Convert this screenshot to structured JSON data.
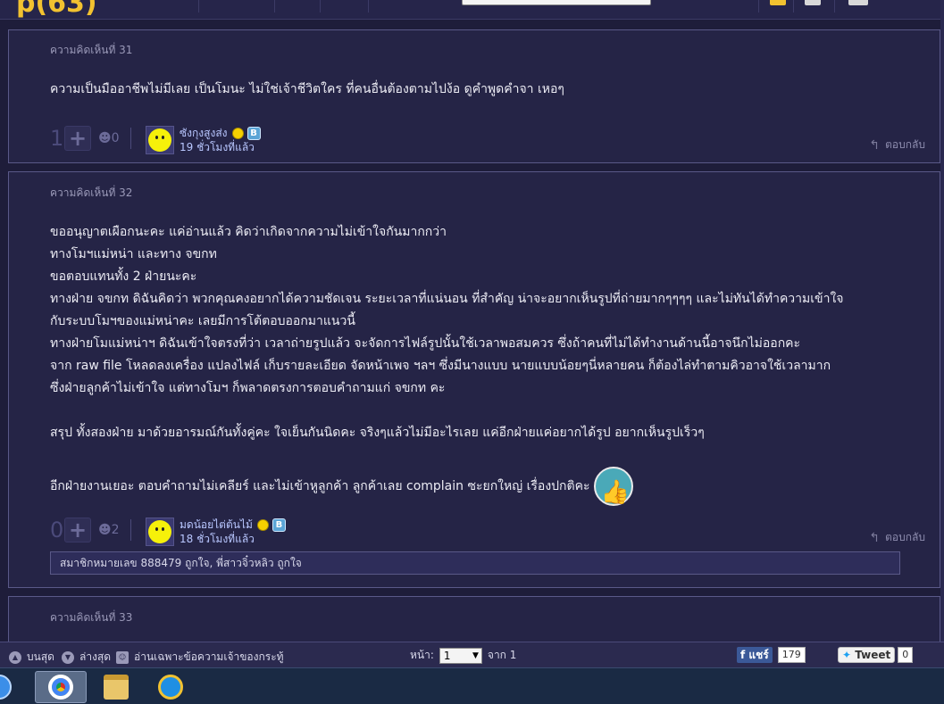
{
  "topbar": {
    "brand": "p(63)"
  },
  "posts": [
    {
      "number": "ความคิดเห็นที่ 31",
      "body": [
        "ความเป็นมืออาชีพไม่มีเลย เป็นโมนะ ไม่ใช่เจ้าชีวิตใคร ที่คนอื่นต้องตามไปง้อ ดูคำพูดคำจา เหอๆ"
      ],
      "votes": "1",
      "emotions": "0",
      "author": "ซังกุงสูงส่ง",
      "badge": "B",
      "time": "19 ชั่วโมงที่แล้ว",
      "reply": "ตอบกลับ"
    },
    {
      "number": "ความคิดเห็นที่ 32",
      "body": [
        "ขออนุญาตเผือกนะคะ แค่อ่านแล้ว คิดว่าเกิดจากความไม่เข้าใจกันมากกว่า",
        "ทางโมฯแม่หน่า และทาง จขกท",
        "ขอตอบแทนทั้ง 2 ฝ่ายนะคะ",
        "ทางฝ่าย จขกท ดิฉันคิดว่า พวกคุณคงอยากได้ความชัดเจน ระยะเวลาที่แน่นอน ที่สำคัญ น่าจะอยากเห็นรูปที่ถ่ายมากๆๆๆๆ และไม่ทันได้ทำความเข้าใจ",
        "กับระบบโมฯของแม่หน่าคะ เลยมีการโต้ตอบออกมาแนวนี้",
        "ทางฝ่ายโมแม่หน่าฯ ดิฉันเข้าใจตรงที่ว่า เวลาถ่ายรูปแล้ว จะจัดการไฟล์รูปนั้นใช้เวลาพอสมควร ซึ่งถ้าคนที่ไม่ได้ทำงานด้านนี้อาจนึกไม่ออกคะ",
        "จาก raw file โหลดลงเครื่อง แปลงไฟล์ เก็บรายละเอียด จัดหน้าเพจ ฯลฯ ซึ่งมีนางแบบ นายแบบน้อยๆนี่หลายคน ก็ต้องไล่ทำตามคิวอาจใช้เวลามาก",
        "ซึ่งฝ่ายลูกค้าไม่เข้าใจ แต่ทางโมฯ ก็พลาดตรงการตอบคำถามแก่ จขกท คะ",
        "",
        "สรุป ทั้งสองฝ่าย มาด้วยอารมณ์กันทั้งคู่คะ ใจเย็นกันนิดคะ จริงๆแล้วไม่มีอะไรเลย แค่อีกฝ่ายแค่อยากได้รูป อยากเห็นรูปเร็วๆ",
        "",
        "อีกฝ่ายงานเยอะ ตอบคำถามไม่เคลียร์ และไม่เข้าหูลูกค้า ลูกค้าเลย complain ซะยกใหญ่  เรื่องปกติคะ"
      ],
      "votes": "0",
      "emotions": "2",
      "author": "มดน้อยไต่ต้นไม้",
      "badge": "B",
      "time": "18 ชั่วโมงที่แล้ว",
      "reply": "ตอบกลับ",
      "likes": "สมาชิกหมายเลข 888479 ถูกใจ, พี่สาวจิ๋วหลิว ถูกใจ"
    },
    {
      "number": "ความคิดเห็นที่ 33"
    }
  ],
  "bottom": {
    "top_label": "บนสุด",
    "bottom_label": "ล่างสุด",
    "owner_only": "อ่านเฉพาะข้อความเจ้าของกระทู้",
    "page_label": "หน้า:",
    "page_value": "1",
    "of_label": "จาก 1",
    "share_label": "แชร์",
    "share_count": "179",
    "tweet_label": "Tweet",
    "tweet_count": "0"
  }
}
